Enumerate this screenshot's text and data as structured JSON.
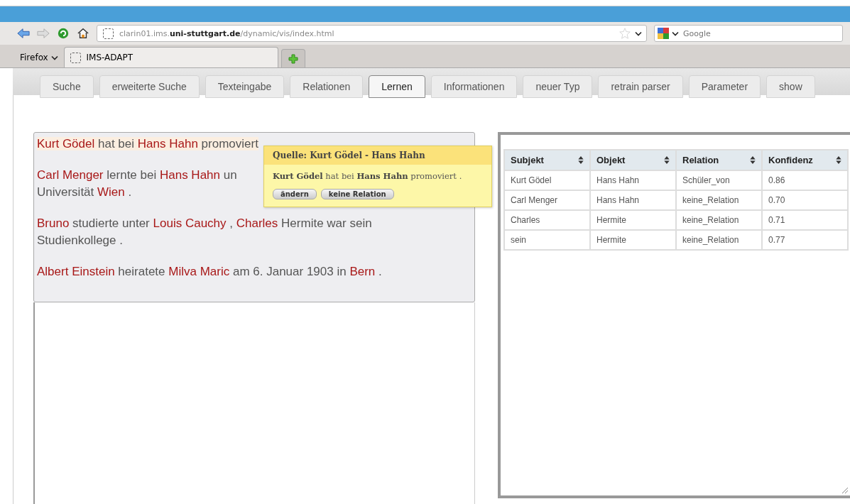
{
  "browser": {
    "url_host_prefix": "clarin01.ims.",
    "url_domain": "uni-stuttgart.de",
    "url_path": "/dynamic/vis/index.html",
    "search_placeholder": "Google",
    "menu_label": "Firefox",
    "tab_title": "IMS-ADAPT"
  },
  "nav_tabs": [
    {
      "label": "Suche",
      "selected": false
    },
    {
      "label": "erweiterte Suche",
      "selected": false
    },
    {
      "label": "Texteingabe",
      "selected": false
    },
    {
      "label": "Relationen",
      "selected": false
    },
    {
      "label": "Lernen",
      "selected": true
    },
    {
      "label": "Informationen",
      "selected": false
    },
    {
      "label": "neuer Typ",
      "selected": false
    },
    {
      "label": "retrain parser",
      "selected": false
    },
    {
      "label": "Parameter",
      "selected": false
    },
    {
      "label": "show",
      "selected": false
    }
  ],
  "sentences": [
    {
      "selected": true,
      "lines": [
        [
          {
            "text": "Kurt Gödel",
            "entity": true
          },
          {
            "text": "hat bei",
            "entity": false
          },
          {
            "text": "Hans Hahn",
            "entity": true
          },
          {
            "text": "promoviert",
            "entity": false
          }
        ]
      ]
    },
    {
      "selected": false,
      "lines": [
        [
          {
            "text": "Carl Menger",
            "entity": true
          },
          {
            "text": "lernte bei",
            "entity": false
          },
          {
            "text": "Hans Hahn",
            "entity": true
          },
          {
            "text": "un",
            "entity": false
          }
        ],
        [
          {
            "text": "Universität",
            "entity": false
          },
          {
            "text": "Wien",
            "entity": true
          },
          {
            "text": ".",
            "entity": false
          }
        ]
      ]
    },
    {
      "selected": false,
      "lines": [
        [
          {
            "text": "Bruno",
            "entity": true
          },
          {
            "text": "studierte unter",
            "entity": false
          },
          {
            "text": "Louis Cauchy",
            "entity": true
          },
          {
            "text": ",",
            "entity": false
          },
          {
            "text": "Charles",
            "entity": true
          },
          {
            "text": "Hermite war sein",
            "entity": false
          }
        ],
        [
          {
            "text": "Studienkollege .",
            "entity": false
          }
        ]
      ]
    },
    {
      "selected": false,
      "lines": [
        [
          {
            "text": "Albert Einstein",
            "entity": true
          },
          {
            "text": "heiratete",
            "entity": false
          },
          {
            "text": "Milva Maric",
            "entity": true
          },
          {
            "text": "am 6. Januar 1903 in",
            "entity": false
          },
          {
            "text": "Bern",
            "entity": true
          },
          {
            "text": ".",
            "entity": false
          }
        ]
      ]
    }
  ],
  "popup": {
    "title": "Quelle: Kurt Gödel - Hans Hahn",
    "sentence": "**Kurt Gödel** hat bei **Hans Hahn** promoviert .",
    "buttons": [
      "ändern",
      "keine Relation"
    ]
  },
  "table": {
    "columns": [
      "Subjekt",
      "Objekt",
      "Relation",
      "Konfidenz"
    ],
    "rows": [
      [
        "Kurt Gödel",
        "Hans Hahn",
        "Schüler_von",
        "0.86"
      ],
      [
        "Carl Menger",
        "Hans Hahn",
        "keine_Relation",
        "0.70"
      ],
      [
        "Charles",
        "Hermite",
        "keine_Relation",
        "0.71"
      ],
      [
        "sein",
        "Hermite",
        "keine_Relation",
        "0.77"
      ]
    ]
  }
}
